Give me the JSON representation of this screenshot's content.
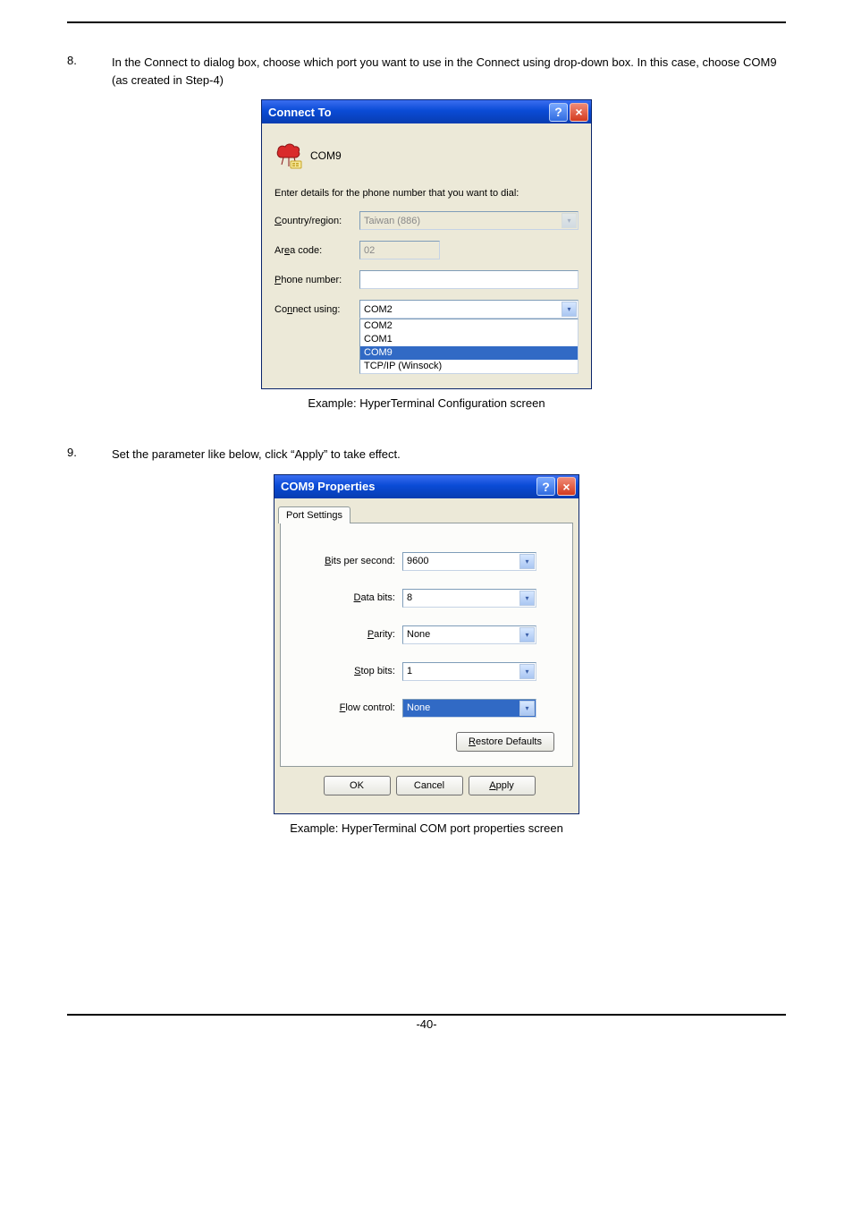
{
  "step8": {
    "num": "8.",
    "text": "In the Connect to dialog box, choose which port you want to use in the Connect using drop-down box. In this case, choose COM9 (as created in Step-4)"
  },
  "step9": {
    "num": "9.",
    "text": "Set the parameter like below, click “Apply” to take effect."
  },
  "dlg1": {
    "title": "Connect To",
    "conn_name": "COM9",
    "prompt": "Enter details for the phone number that you want to dial:",
    "labels": {
      "country": "ountry/region:",
      "country_u": "C",
      "area": "Ar",
      "area_u": "e",
      "area_tail": "a code:",
      "phone": "hone number:",
      "phone_u": "P",
      "connect": "Co",
      "connect_u": "n",
      "connect_tail": "nect using:"
    },
    "values": {
      "country": "Taiwan (886)",
      "area": "02",
      "phone": "",
      "connect": "COM2"
    },
    "options": [
      "COM2",
      "COM1",
      "COM9",
      "TCP/IP (Winsock)"
    ],
    "selected_index": 2
  },
  "caption1": "Example: HyperTerminal Configuration screen",
  "dlg2": {
    "title": "COM9 Properties",
    "tab": "Port Settings",
    "rows": {
      "bits_lbl_u": "B",
      "bits_lbl": "its per second:",
      "bits_val": "9600",
      "data_lbl_u": "D",
      "data_lbl": "ata bits:",
      "data_val": "8",
      "parity_lbl_u": "P",
      "parity_lbl": "arity:",
      "parity_val": "None",
      "stop_lbl_u": "S",
      "stop_lbl": "top bits:",
      "stop_val": "1",
      "flow_lbl_u": "F",
      "flow_lbl": "low control:",
      "flow_val": "None"
    },
    "restore_u": "R",
    "restore": "estore Defaults",
    "ok": "OK",
    "cancel": "Cancel",
    "apply_u": "A",
    "apply": "pply"
  },
  "caption2": "Example: HyperTerminal COM port properties screen",
  "page_number": "-40-"
}
